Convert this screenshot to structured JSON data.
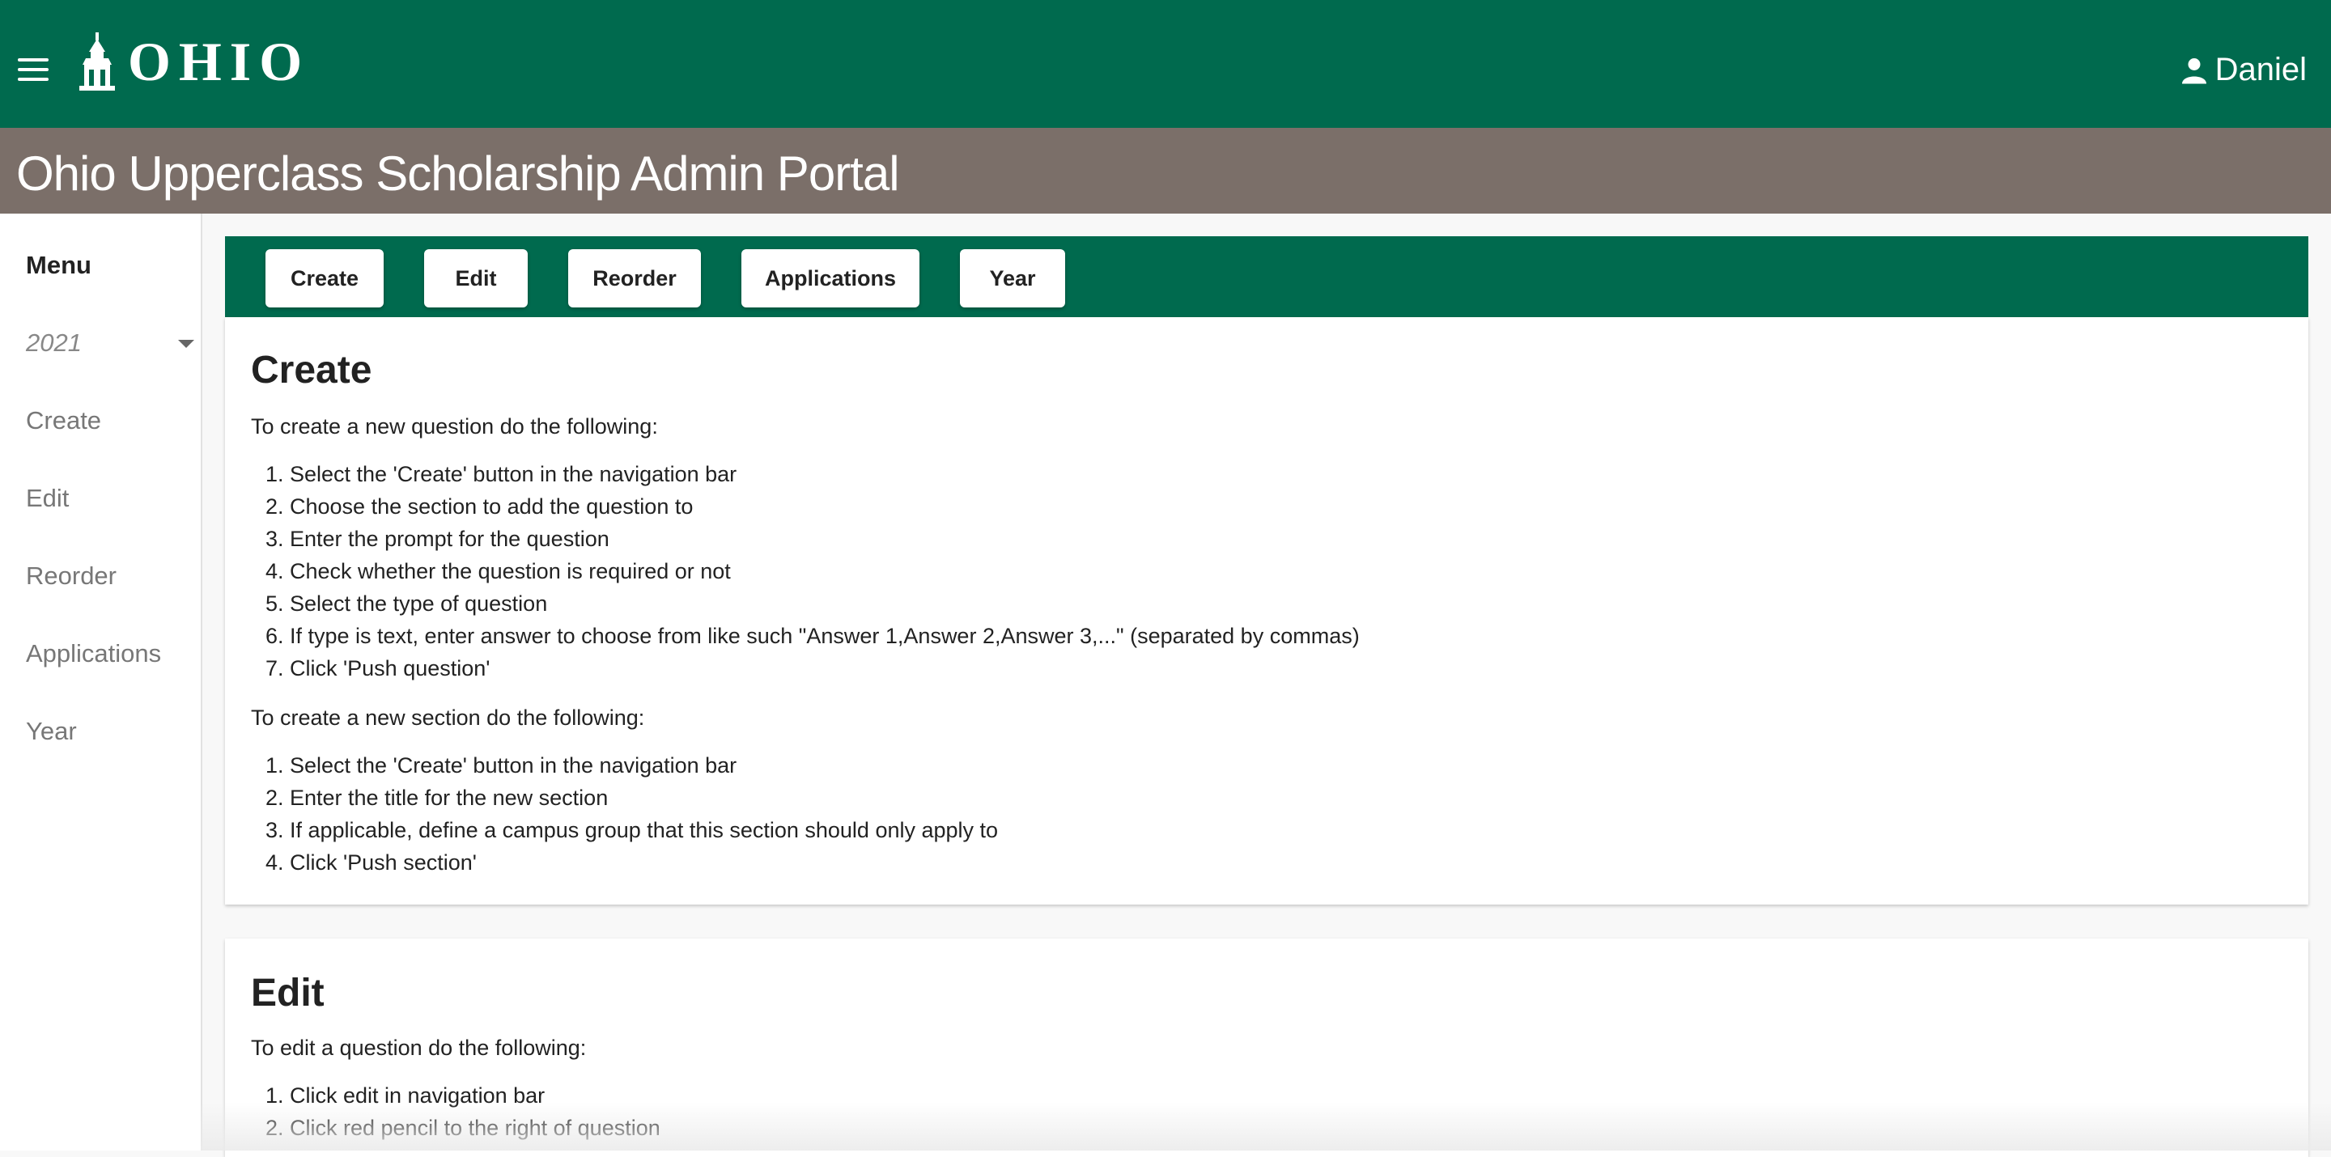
{
  "header": {
    "brand": "OHIO",
    "user_name": "Daniel"
  },
  "title_bar": {
    "title": "Ohio Upperclass Scholarship Admin Portal"
  },
  "sidebar": {
    "menu_title": "Menu",
    "year_selected": "2021",
    "items": [
      {
        "label": "Create"
      },
      {
        "label": "Edit"
      },
      {
        "label": "Reorder"
      },
      {
        "label": "Applications"
      },
      {
        "label": "Year"
      }
    ]
  },
  "navbar": {
    "buttons": [
      {
        "label": "Create"
      },
      {
        "label": "Edit"
      },
      {
        "label": "Reorder"
      },
      {
        "label": "Applications"
      },
      {
        "label": "Year"
      }
    ]
  },
  "create_section": {
    "heading": "Create",
    "question_intro": "To create a new question do the following:",
    "question_steps": [
      "Select the 'Create' button in the navigation bar",
      "Choose the section to add the question to",
      "Enter the prompt for the question",
      "Check whether the question is required or not",
      "Select the type of question",
      "If type is text, enter answer to choose from like such \"Answer 1,Answer 2,Answer 3,...\" (separated by commas)",
      "Click 'Push question'"
    ],
    "section_intro": "To create a new section do the following:",
    "section_steps": [
      "Select the 'Create' button in the navigation bar",
      "Enter the title for the new section",
      "If applicable, define a campus group that this section should only apply to",
      "Click 'Push section'"
    ]
  },
  "edit_section": {
    "heading": "Edit",
    "question_intro": "To edit a question do the following:",
    "question_steps": [
      "Click edit in navigation bar",
      "Click red pencil to the right of question"
    ]
  },
  "colors": {
    "primary_green": "#006a4e",
    "title_bar_brown": "#7b6f69"
  },
  "icons": {
    "menu": "hamburger-icon",
    "logo": "cupola-icon",
    "user": "person-icon",
    "dropdown": "caret-down-icon"
  }
}
